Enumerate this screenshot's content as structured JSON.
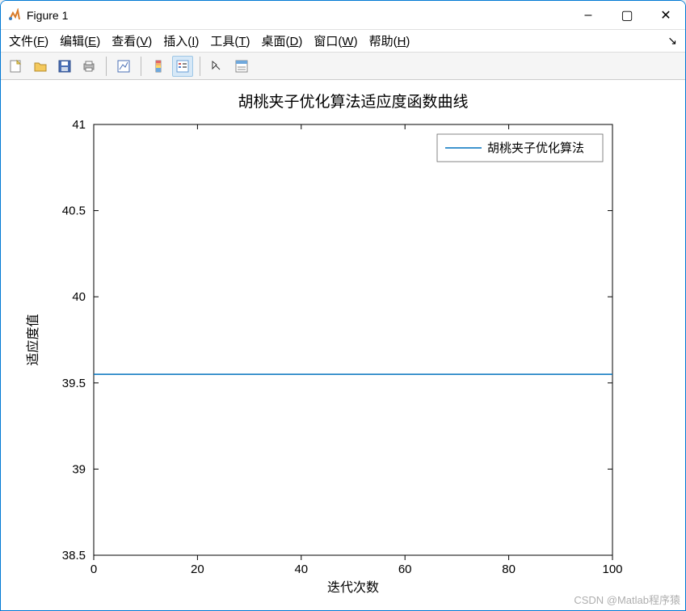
{
  "window": {
    "title": "Figure 1",
    "controls": {
      "min": "–",
      "max": "▢",
      "close": "✕"
    }
  },
  "menu": {
    "file": "文件(F)",
    "edit": "编辑(E)",
    "view": "查看(V)",
    "insert": "插入(I)",
    "tools": "工具(T)",
    "desktop": "桌面(D)",
    "window": "窗口(W)",
    "help": "帮助(H)"
  },
  "chart_data": {
    "type": "line",
    "title": "胡桃夹子优化算法适应度函数曲线",
    "xlabel": "迭代次数",
    "ylabel": "适应度值",
    "xlim": [
      0,
      100
    ],
    "ylim": [
      38.5,
      41
    ],
    "xticks": [
      0,
      20,
      40,
      60,
      80,
      100
    ],
    "yticks": [
      38.5,
      39,
      39.5,
      40,
      40.5,
      41
    ],
    "series": [
      {
        "name": "胡桃夹子优化算法",
        "color": "#0072bd",
        "x": [
          0,
          100
        ],
        "y": [
          39.55,
          39.55
        ]
      }
    ],
    "legend": {
      "position": "top-right",
      "items": [
        "胡桃夹子优化算法"
      ]
    }
  },
  "watermark": "CSDN @Matlab程序猿"
}
